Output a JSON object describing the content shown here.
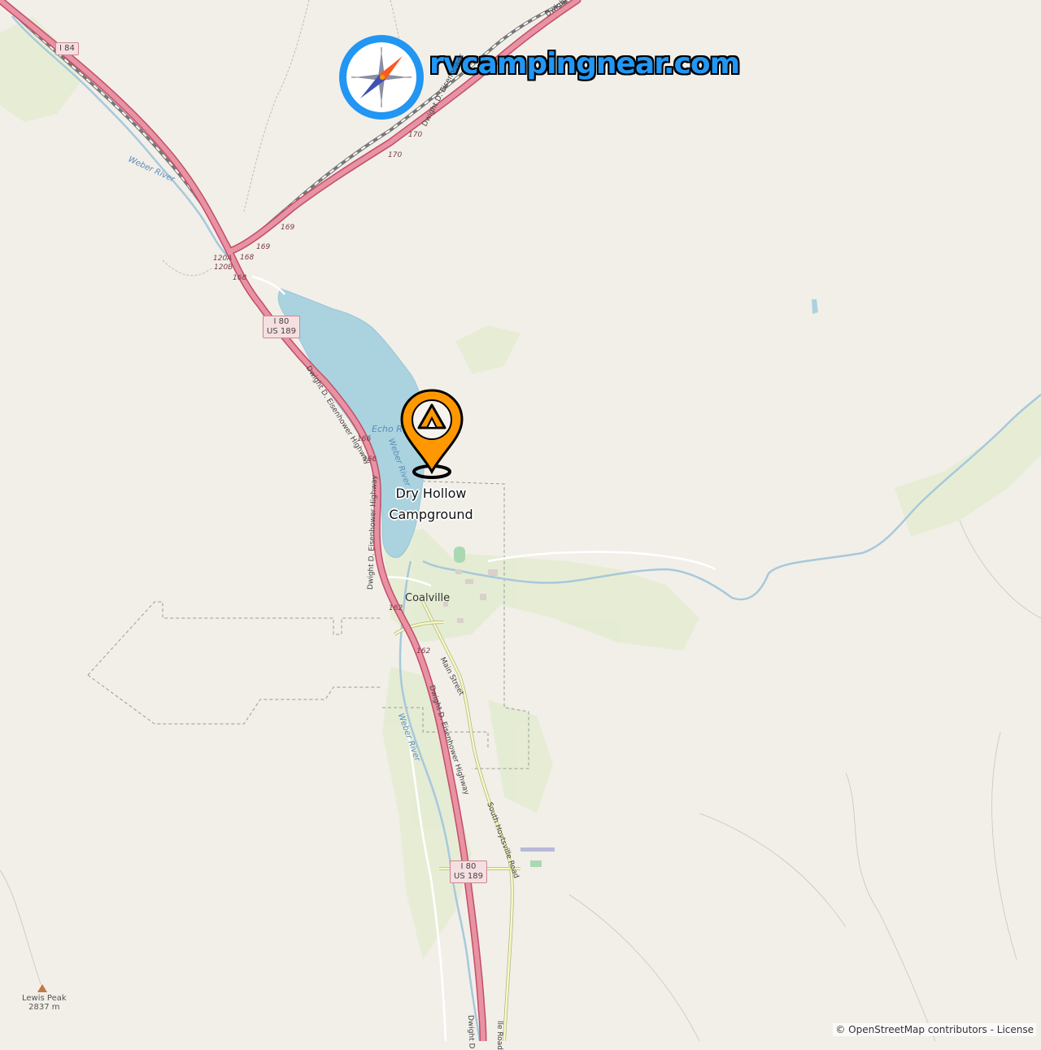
{
  "brand": {
    "text": "rvcampingnear.com"
  },
  "marker": {
    "name_line1": "Dry Hollow",
    "name_line2": "Campground"
  },
  "places": {
    "town": "Coalville",
    "peak_name": "Lewis Peak",
    "peak_elevation": "2837 m"
  },
  "water": {
    "reservoir": "Echo Reservoir",
    "river1": "Weber River",
    "river2": "Weber River",
    "river3": "Weber River"
  },
  "shields": {
    "i84": "I 84",
    "north_i80": "I 80",
    "north_us189": "US 189",
    "south_i80": "I 80",
    "south_us189": "US 189"
  },
  "roads": {
    "highway_top": "Dwight D. Eisenhower",
    "highway_top2": "Dwight D",
    "highway_mid": "Dwight D. Eisenhower Highway",
    "highway_mid2": "Dwight D. Eisenhower Highway",
    "highway_south": "Dwight D. Eisenhower Highway",
    "highway_bottom": "Dwight D",
    "main_street": "Main Street",
    "south_hoytsville": "South Hoytsville Road",
    "bottom_road": "lle Road"
  },
  "exits": {
    "e170a": "170",
    "e170b": "170",
    "e169a": "169",
    "e169b": "169",
    "e168a": "168",
    "e168b": "168",
    "e120a": "120A",
    "e120b": "120B",
    "e166a": "166",
    "e166b": "166",
    "e162a": "162",
    "e162b": "162"
  },
  "attribution": {
    "text": "© OpenStreetMap contributors - License"
  },
  "colors": {
    "land": "#f2efe9",
    "water": "#aad3df",
    "motorway": "#e892a2",
    "motorway_casing": "#c24e6b",
    "secondary": "#f7fabf",
    "river": "#a6c9dc",
    "marker": "#ff9800",
    "brand": "#2196f3"
  },
  "icons": {
    "compass": "compass-logo-icon",
    "marker": "campground-pin-icon"
  }
}
